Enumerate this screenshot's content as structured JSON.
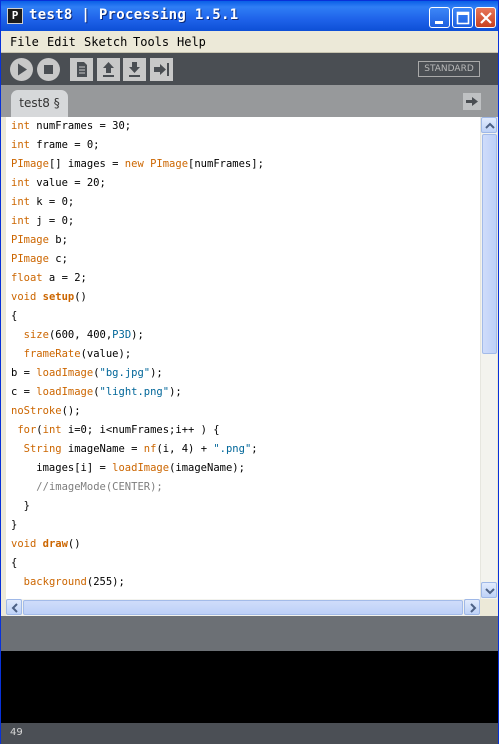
{
  "window": {
    "app_icon_letter": "P",
    "title": "test8 | Processing 1.5.1"
  },
  "menu": {
    "items": [
      "File",
      "Edit",
      "Sketch",
      "Tools",
      "Help"
    ]
  },
  "toolbar": {
    "mode_label": "STANDARD"
  },
  "tabs": {
    "active_label": "test8 §"
  },
  "editor": {
    "lines": [
      "int numFrames = 30;",
      "int frame = 0;",
      "PImage[] images = new PImage[numFrames];",
      "int value = 20;",
      "int k = 0;",
      "int j = 0;",
      "PImage b;",
      "PImage c;",
      "float a = 2;",
      "void setup()",
      "{",
      "  size(600, 400,P3D);",
      "  frameRate(value);",
      "b = loadImage(\"bg.jpg\");",
      "c = loadImage(\"light.png\");",
      "noStroke();",
      " for(int i=0; i<numFrames;i++ ) {",
      "  String imageName = nf(i, 4) + \".png\";",
      "    images[i] = loadImage(imageName);",
      "    //imageMode(CENTER);",
      "  }",
      "}",
      "void draw()",
      "{",
      "  background(255);",
      "  ..."
    ]
  },
  "status": {
    "line_number": "49"
  },
  "colors": {
    "keyword": "#cc6600",
    "string": "#006699",
    "comment": "#7e7e7e",
    "title_bar": "#0a5fe7",
    "toolbar": "#4a4e53",
    "console": "#000000"
  }
}
